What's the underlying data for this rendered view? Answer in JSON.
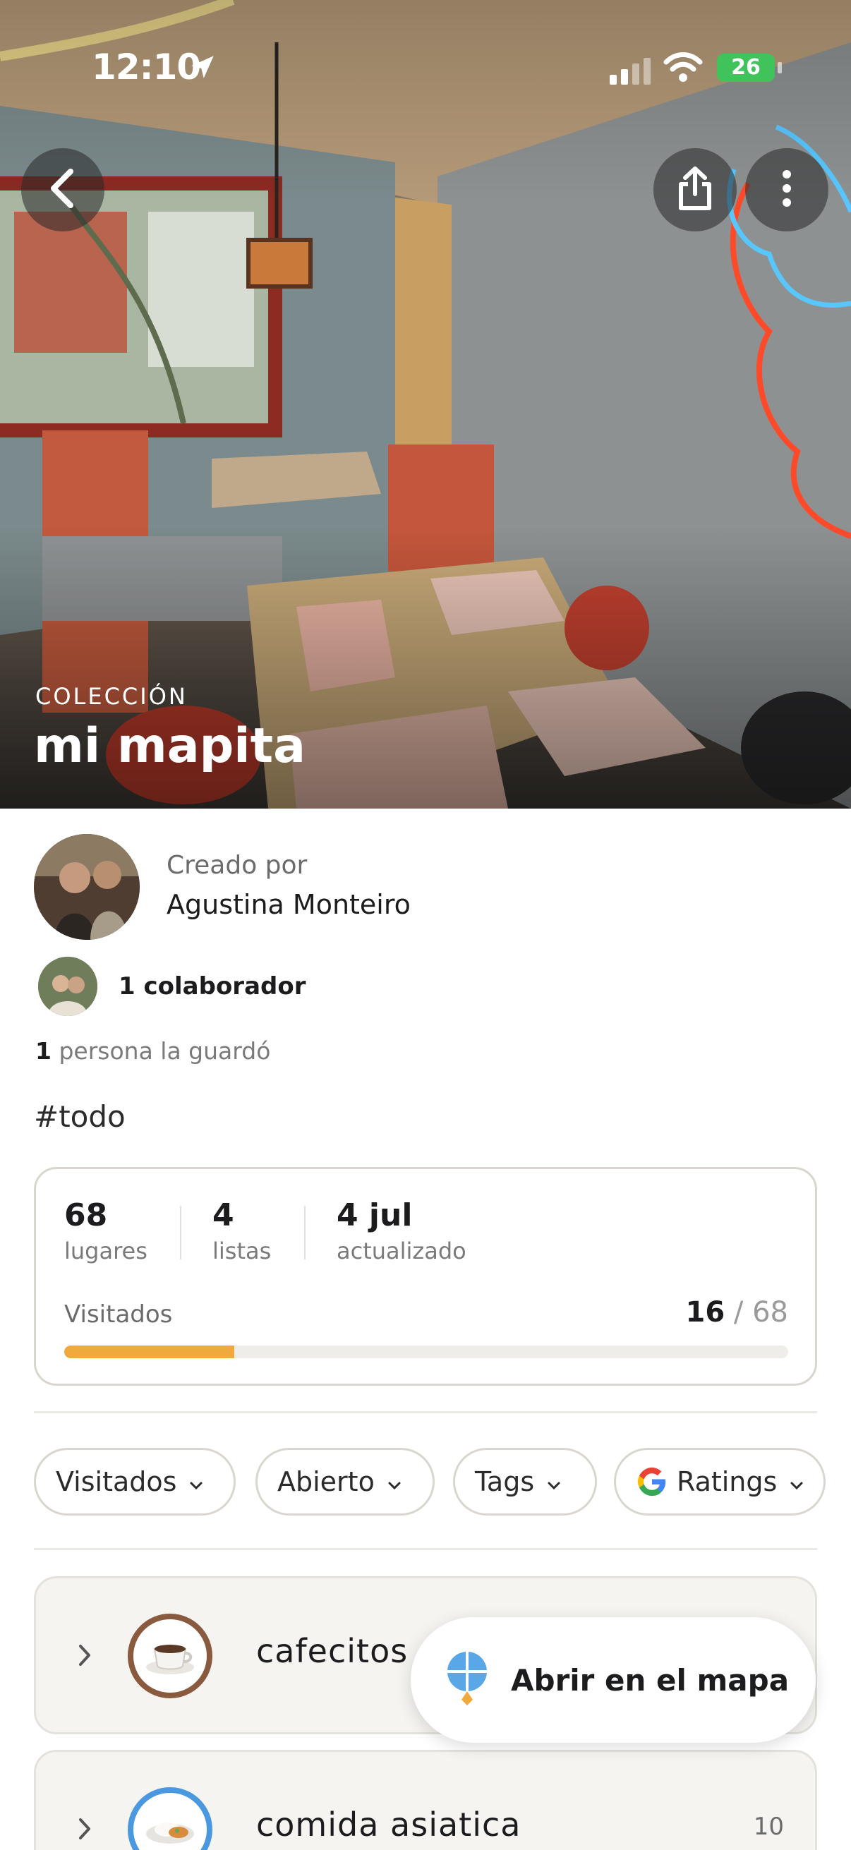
{
  "status_bar": {
    "time": "12:10",
    "battery": "26"
  },
  "hero": {
    "kicker": "COLECCIÓN",
    "title": "mi mapita"
  },
  "creator": {
    "label": "Creado por",
    "name": "Agustina Monteiro"
  },
  "collaborators": {
    "text": "1 colaborador"
  },
  "saved": {
    "count": "1",
    "text": "persona la guardó"
  },
  "hashtag": "#todo",
  "stats": {
    "places": {
      "value": "68",
      "label": "lugares"
    },
    "lists": {
      "value": "4",
      "label": "listas"
    },
    "updated": {
      "value": "4 jul",
      "label": "actualizado"
    },
    "visited": {
      "label": "Visitados",
      "done": "16",
      "total": "/ 68",
      "fraction": 0.235
    }
  },
  "filters": [
    {
      "label": "Visitados"
    },
    {
      "label": "Abierto"
    },
    {
      "label": "Tags"
    },
    {
      "label": "Ratings"
    }
  ],
  "lists": [
    {
      "name": "cafecitos",
      "count": "",
      "icon": "coffee-cup-icon"
    },
    {
      "name": "comida asiatica",
      "count": "10",
      "icon": "rice-plate-icon"
    }
  ],
  "map_button": {
    "label": "Abrir en el mapa"
  },
  "colors": {
    "accent": "#f0a93c",
    "card_border": "#d9d6cf",
    "list_bg": "#f5f4f1"
  }
}
